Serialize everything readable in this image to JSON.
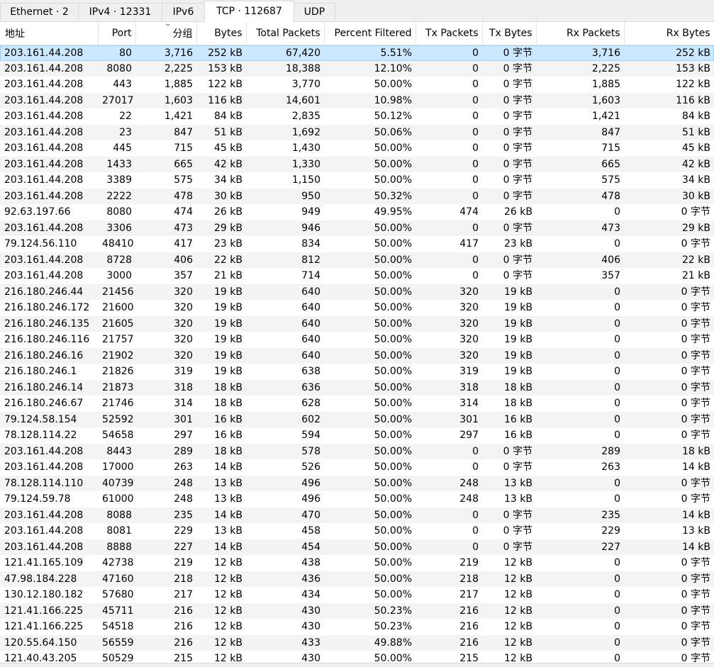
{
  "tabs": [
    {
      "label": "Ethernet · 2",
      "active": false
    },
    {
      "label": "IPv4 · 12331",
      "active": false
    },
    {
      "label": "IPv6",
      "active": false
    },
    {
      "label": "TCP · 112687",
      "active": true
    },
    {
      "label": "UDP",
      "active": false
    }
  ],
  "table": {
    "columns": [
      "地址",
      "Port",
      "分组",
      "Bytes",
      "Total Packets",
      "Percent Filtered",
      "Tx Packets",
      "Tx Bytes",
      "Rx Packets",
      "Rx Bytes"
    ],
    "sort_column": "分组",
    "sort_direction": "descending",
    "selected_row": 0,
    "rows": [
      [
        "203.161.44.208",
        "80",
        "3,716",
        "252 kB",
        "67,420",
        "5.51%",
        "0",
        "0 字节",
        "3,716",
        "252 kB"
      ],
      [
        "203.161.44.208",
        "8080",
        "2,225",
        "153 kB",
        "18,388",
        "12.10%",
        "0",
        "0 字节",
        "2,225",
        "153 kB"
      ],
      [
        "203.161.44.208",
        "443",
        "1,885",
        "122 kB",
        "3,770",
        "50.00%",
        "0",
        "0 字节",
        "1,885",
        "122 kB"
      ],
      [
        "203.161.44.208",
        "27017",
        "1,603",
        "116 kB",
        "14,601",
        "10.98%",
        "0",
        "0 字节",
        "1,603",
        "116 kB"
      ],
      [
        "203.161.44.208",
        "22",
        "1,421",
        "84 kB",
        "2,835",
        "50.12%",
        "0",
        "0 字节",
        "1,421",
        "84 kB"
      ],
      [
        "203.161.44.208",
        "23",
        "847",
        "51 kB",
        "1,692",
        "50.06%",
        "0",
        "0 字节",
        "847",
        "51 kB"
      ],
      [
        "203.161.44.208",
        "445",
        "715",
        "45 kB",
        "1,430",
        "50.00%",
        "0",
        "0 字节",
        "715",
        "45 kB"
      ],
      [
        "203.161.44.208",
        "1433",
        "665",
        "42 kB",
        "1,330",
        "50.00%",
        "0",
        "0 字节",
        "665",
        "42 kB"
      ],
      [
        "203.161.44.208",
        "3389",
        "575",
        "34 kB",
        "1,150",
        "50.00%",
        "0",
        "0 字节",
        "575",
        "34 kB"
      ],
      [
        "203.161.44.208",
        "2222",
        "478",
        "30 kB",
        "950",
        "50.32%",
        "0",
        "0 字节",
        "478",
        "30 kB"
      ],
      [
        "92.63.197.66",
        "8080",
        "474",
        "26 kB",
        "949",
        "49.95%",
        "474",
        "26 kB",
        "0",
        "0 字节"
      ],
      [
        "203.161.44.208",
        "3306",
        "473",
        "29 kB",
        "946",
        "50.00%",
        "0",
        "0 字节",
        "473",
        "29 kB"
      ],
      [
        "79.124.56.110",
        "48410",
        "417",
        "23 kB",
        "834",
        "50.00%",
        "417",
        "23 kB",
        "0",
        "0 字节"
      ],
      [
        "203.161.44.208",
        "8728",
        "406",
        "22 kB",
        "812",
        "50.00%",
        "0",
        "0 字节",
        "406",
        "22 kB"
      ],
      [
        "203.161.44.208",
        "3000",
        "357",
        "21 kB",
        "714",
        "50.00%",
        "0",
        "0 字节",
        "357",
        "21 kB"
      ],
      [
        "216.180.246.44",
        "21456",
        "320",
        "19 kB",
        "640",
        "50.00%",
        "320",
        "19 kB",
        "0",
        "0 字节"
      ],
      [
        "216.180.246.172",
        "21600",
        "320",
        "19 kB",
        "640",
        "50.00%",
        "320",
        "19 kB",
        "0",
        "0 字节"
      ],
      [
        "216.180.246.135",
        "21605",
        "320",
        "19 kB",
        "640",
        "50.00%",
        "320",
        "19 kB",
        "0",
        "0 字节"
      ],
      [
        "216.180.246.116",
        "21757",
        "320",
        "19 kB",
        "640",
        "50.00%",
        "320",
        "19 kB",
        "0",
        "0 字节"
      ],
      [
        "216.180.246.16",
        "21902",
        "320",
        "19 kB",
        "640",
        "50.00%",
        "320",
        "19 kB",
        "0",
        "0 字节"
      ],
      [
        "216.180.246.1",
        "21826",
        "319",
        "19 kB",
        "638",
        "50.00%",
        "319",
        "19 kB",
        "0",
        "0 字节"
      ],
      [
        "216.180.246.14",
        "21873",
        "318",
        "18 kB",
        "636",
        "50.00%",
        "318",
        "18 kB",
        "0",
        "0 字节"
      ],
      [
        "216.180.246.67",
        "21746",
        "314",
        "18 kB",
        "628",
        "50.00%",
        "314",
        "18 kB",
        "0",
        "0 字节"
      ],
      [
        "79.124.58.154",
        "52592",
        "301",
        "16 kB",
        "602",
        "50.00%",
        "301",
        "16 kB",
        "0",
        "0 字节"
      ],
      [
        "78.128.114.22",
        "54658",
        "297",
        "16 kB",
        "594",
        "50.00%",
        "297",
        "16 kB",
        "0",
        "0 字节"
      ],
      [
        "203.161.44.208",
        "8443",
        "289",
        "18 kB",
        "578",
        "50.00%",
        "0",
        "0 字节",
        "289",
        "18 kB"
      ],
      [
        "203.161.44.208",
        "17000",
        "263",
        "14 kB",
        "526",
        "50.00%",
        "0",
        "0 字节",
        "263",
        "14 kB"
      ],
      [
        "78.128.114.110",
        "40739",
        "248",
        "13 kB",
        "496",
        "50.00%",
        "248",
        "13 kB",
        "0",
        "0 字节"
      ],
      [
        "79.124.59.78",
        "61000",
        "248",
        "13 kB",
        "496",
        "50.00%",
        "248",
        "13 kB",
        "0",
        "0 字节"
      ],
      [
        "203.161.44.208",
        "8088",
        "235",
        "14 kB",
        "470",
        "50.00%",
        "0",
        "0 字节",
        "235",
        "14 kB"
      ],
      [
        "203.161.44.208",
        "8081",
        "229",
        "13 kB",
        "458",
        "50.00%",
        "0",
        "0 字节",
        "229",
        "13 kB"
      ],
      [
        "203.161.44.208",
        "8888",
        "227",
        "14 kB",
        "454",
        "50.00%",
        "0",
        "0 字节",
        "227",
        "14 kB"
      ],
      [
        "121.41.165.109",
        "42738",
        "219",
        "12 kB",
        "438",
        "50.00%",
        "219",
        "12 kB",
        "0",
        "0 字节"
      ],
      [
        "47.98.184.228",
        "47160",
        "218",
        "12 kB",
        "436",
        "50.00%",
        "218",
        "12 kB",
        "0",
        "0 字节"
      ],
      [
        "130.12.180.182",
        "57680",
        "217",
        "12 kB",
        "434",
        "50.00%",
        "217",
        "12 kB",
        "0",
        "0 字节"
      ],
      [
        "121.41.166.225",
        "45711",
        "216",
        "12 kB",
        "430",
        "50.23%",
        "216",
        "12 kB",
        "0",
        "0 字节"
      ],
      [
        "121.41.166.225",
        "54518",
        "216",
        "12 kB",
        "430",
        "50.23%",
        "216",
        "12 kB",
        "0",
        "0 字节"
      ],
      [
        "120.55.64.150",
        "56559",
        "216",
        "12 kB",
        "433",
        "49.88%",
        "216",
        "12 kB",
        "0",
        "0 字节"
      ],
      [
        "121.40.43.205",
        "50529",
        "215",
        "12 kB",
        "430",
        "50.00%",
        "215",
        "12 kB",
        "0",
        "0 字节"
      ]
    ]
  }
}
